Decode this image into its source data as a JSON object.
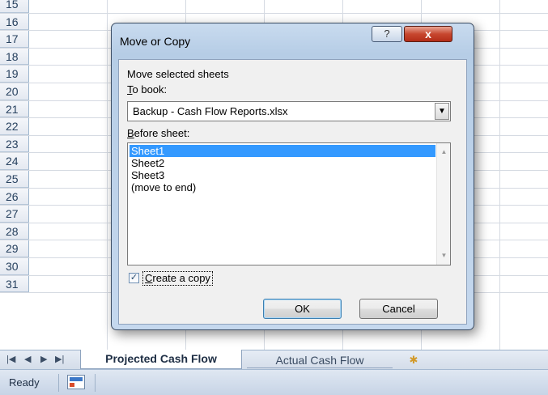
{
  "rows": [
    "15",
    "16",
    "17",
    "18",
    "19",
    "20",
    "21",
    "22",
    "23",
    "24",
    "25",
    "26",
    "27",
    "28",
    "29",
    "30",
    "31"
  ],
  "dialog": {
    "title": "Move or Copy",
    "help_label": "?",
    "close_label": "x",
    "move_label": "Move selected sheets",
    "to_book_label": "o book:",
    "to_book_mnemonic": "T",
    "to_book_value": "Backup - Cash Flow Reports.xlsx",
    "before_sheet_label": "efore sheet:",
    "before_sheet_mnemonic": "B",
    "sheets": [
      "Sheet1",
      "Sheet2",
      "Sheet3",
      "(move to end)"
    ],
    "selected_sheet": "Sheet1",
    "copy_label": "reate a copy",
    "copy_mnemonic": "C",
    "copy_checked": true,
    "ok_label": "OK",
    "cancel_label": "Cancel"
  },
  "tabs": {
    "active": "Projected Cash Flow",
    "inactive": "Actual Cash Flow",
    "nav_first": "⏮",
    "nav_prev": "◀",
    "nav_next": "▶",
    "nav_last": "⏭"
  },
  "status": {
    "text": "Ready"
  },
  "icons": {
    "dropdown": "chevron-down-icon",
    "scroll_up": "chevron-up-icon",
    "scroll_down": "chevron-down-icon",
    "new_sheet": "insert-sheet-icon",
    "macro": "record-macro-icon"
  }
}
